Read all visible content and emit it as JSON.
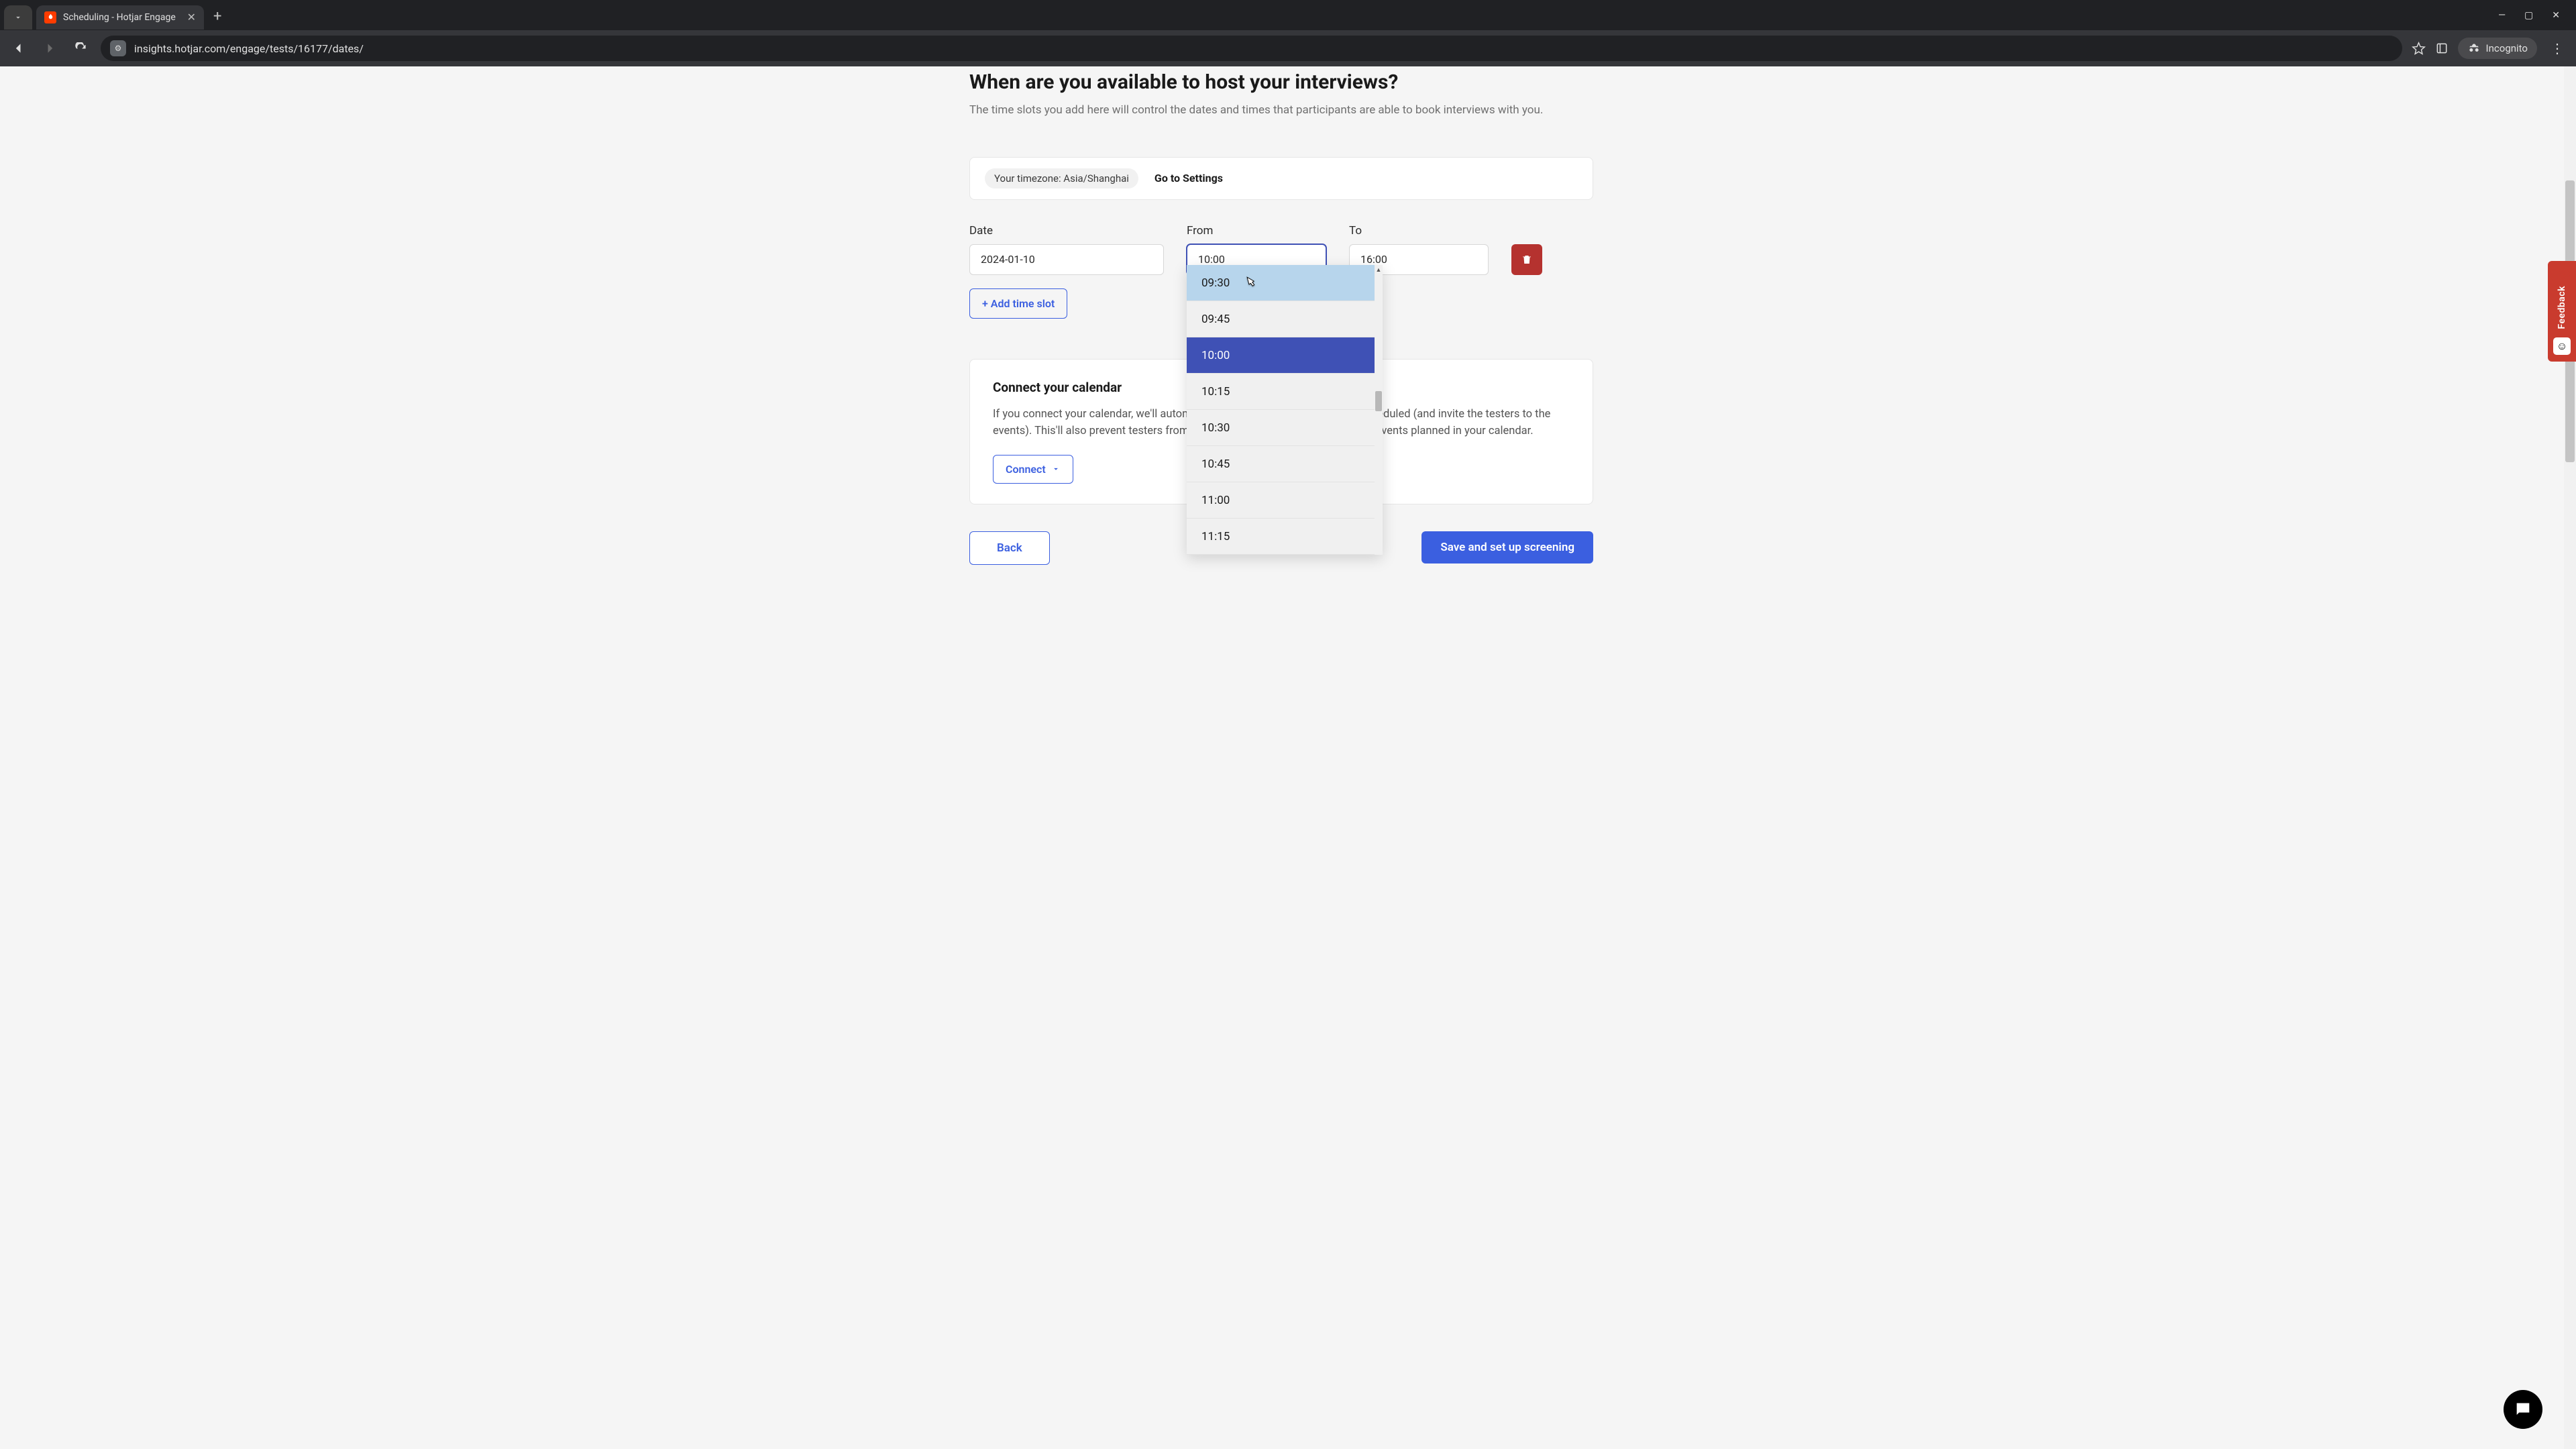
{
  "browser": {
    "tab_title": "Scheduling - Hotjar Engage",
    "url": "insights.hotjar.com/engage/tests/16177/dates/",
    "incognito_label": "Incognito"
  },
  "page": {
    "heading": "When are you available to host your interviews?",
    "subtext": "The time slots you add here will control the dates and times that participants are able to book interviews with you.",
    "timezone_prefix": "Your timezone: ",
    "timezone_value": "Asia/Shanghai",
    "timezone_link": "Go to Settings",
    "labels": {
      "date": "Date",
      "from": "From",
      "to": "To"
    },
    "slot": {
      "date": "2024-01-10",
      "from": "10:00",
      "to": "16:00"
    },
    "add_slot_label": "+ Add time slot",
    "dropdown": {
      "hovered": "09:30",
      "selected": "10:00",
      "options": [
        "09:30",
        "09:45",
        "10:00",
        "10:15",
        "10:30",
        "10:45",
        "11:00",
        "11:15"
      ]
    },
    "connect": {
      "title": "Connect your calendar",
      "text": "If you connect your calendar, we'll automatically add interviews as they get scheduled (and invite the testers to the events). This'll also prevent testers from booking interviews at times you have events planned in your calendar.",
      "button": "Connect"
    },
    "footer": {
      "back": "Back",
      "save": "Save and set up screening"
    },
    "feedback_label": "Feedback"
  }
}
